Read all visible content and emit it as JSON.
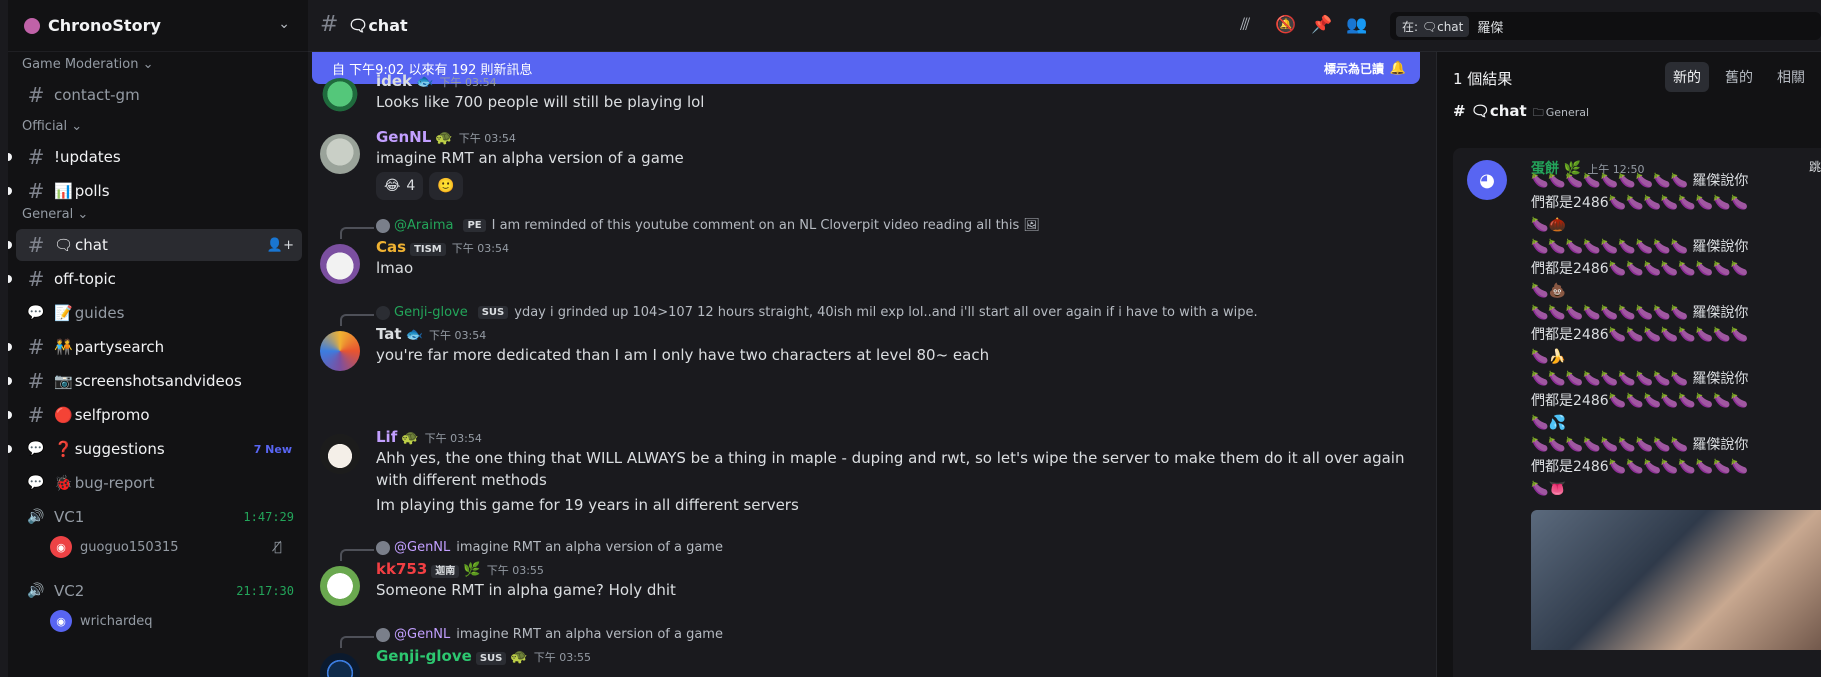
{
  "server": {
    "name": "ChronoStory"
  },
  "sidebar": {
    "categories": [
      "Game Moderation",
      "Official",
      "General"
    ],
    "channels": [
      {
        "name": "contact-gm",
        "emoji": "",
        "kind": "text"
      },
      {
        "name": "!updates",
        "emoji": "",
        "kind": "text"
      },
      {
        "name": "polls",
        "emoji": "📊",
        "kind": "text"
      },
      {
        "name": "chat",
        "emoji": "🗨",
        "kind": "text"
      },
      {
        "name": "off-topic",
        "emoji": "",
        "kind": "text"
      },
      {
        "name": "guides",
        "emoji": "📝",
        "kind": "forum"
      },
      {
        "name": "partysearch",
        "emoji": "🧑‍🤝‍🧑",
        "kind": "text"
      },
      {
        "name": "screenshotsandvideos",
        "emoji": "📷",
        "kind": "text"
      },
      {
        "name": "selfpromo",
        "emoji": "🔴",
        "kind": "text"
      },
      {
        "name": "suggestions",
        "emoji": "❓",
        "kind": "forum",
        "badge": "7 New"
      },
      {
        "name": "bug-report",
        "emoji": "🐞",
        "kind": "forum"
      }
    ],
    "voice": [
      {
        "name": "VC1",
        "timer": "1:47:29",
        "users": [
          "guoguo150315"
        ]
      },
      {
        "name": "VC2",
        "timer": "21:17:30",
        "users": [
          "wrichardeq"
        ]
      }
    ]
  },
  "header": {
    "channel": "🗨chat",
    "search_chip": "在: 🗨chat",
    "search_value": "羅傑"
  },
  "banner": {
    "text": "自 下午9:02 以來有 192 則新訊息",
    "action": "標示為已讀"
  },
  "messages": [
    {
      "user": "idek",
      "time": "下午 03:54",
      "text": "Looks like 700 people will still be playing lol",
      "deco": "🐟",
      "color": "#dbdee1"
    },
    {
      "user": "GenNL",
      "time": "下午 03:54",
      "text": "imagine RMT an alpha version of a game",
      "deco": "🐢",
      "color": "#c29fff",
      "reactions": [
        {
          "emoji": "😂",
          "count": "4"
        },
        {
          "emoji": "🙂",
          "count": ""
        }
      ]
    },
    {
      "user": "Cas",
      "tag": "TISM",
      "time": "下午 03:54",
      "text": "lmao",
      "color": "#f0b232",
      "reply": {
        "user": "@Araima",
        "tag": "PE",
        "text": "I am reminded of this youtube comment on an NL Cloverpit video reading all this"
      }
    },
    {
      "user": "Tat",
      "time": "下午 03:54",
      "text": "you're far more dedicated than I am I only have two characters at level 80~ each",
      "deco": "🐟",
      "color": "#dbdee1",
      "reply": {
        "user": "Genji-glove",
        "tag": "SUS",
        "text": "yday i grinded up 104>107 12 hours straight, 40ish mil exp lol..and i'll start all over again if i have to with a wipe."
      }
    },
    {
      "user": "Lif",
      "time": "下午 03:54",
      "text": "Ahh yes, the one thing that WILL ALWAYS be a thing in maple - duping and rwt, so let's wipe the server to make them do it all over again with different methods",
      "text2": "Im playing this game for 19 years in all different servers",
      "deco": "🐢",
      "color": "#c29fff"
    },
    {
      "user": "kk753",
      "tag": "迦南",
      "time": "下午 03:55",
      "text": "Someone RMT in alpha game? Holy dhit",
      "color": "#f23f43",
      "reply": {
        "user": "@GenNL",
        "tag": "",
        "text": "imagine RMT an alpha version of a game"
      }
    },
    {
      "user": "Genji-glove",
      "tag": "SUS",
      "time": "下午 03:55",
      "text": "",
      "color": "#2dc770",
      "reply": {
        "user": "@GenNL",
        "tag": "",
        "text": "imagine RMT an alpha version of a game"
      }
    }
  ],
  "results": {
    "count": "1 個結果",
    "sort": [
      "新的",
      "舊的",
      "相關"
    ],
    "group": "# 🗨chat",
    "group_category": "General",
    "author": "蛋餅",
    "time": "上午 12:50",
    "jump": "跳至",
    "phrase": "羅傑說你",
    "line2": "們都是2486",
    "emojis": [
      "🌰",
      "💩",
      "🍌",
      "💦",
      "👅"
    ]
  },
  "colors": {
    "accent": "#5865f2",
    "online": "#23a55a",
    "bg": "#1a1a1e",
    "sidebar": "#121214"
  }
}
